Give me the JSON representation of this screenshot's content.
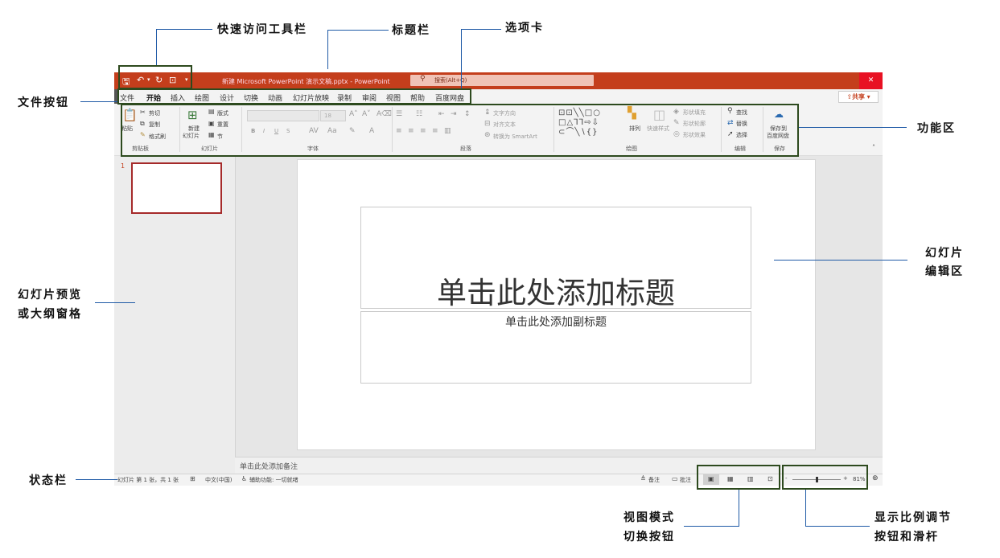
{
  "annotations": {
    "qat": "快速访问工具栏",
    "titlebar": "标题栏",
    "tabs": "选项卡",
    "file_button": "文件按钮",
    "ribbon": "功能区",
    "edit_area_1": "幻灯片",
    "edit_area_2": "编辑区",
    "preview_1": "幻灯片预览",
    "preview_2": "或大纲窗格",
    "statusbar": "状态栏",
    "view_buttons_1": "视图模式",
    "view_buttons_2": "切换按钮",
    "zoom_1": "显示比例调节",
    "zoom_2": "按钮和滑杆"
  },
  "window": {
    "title": "新建 Microsoft PowerPoint 演示文稿.pptx - PowerPoint",
    "search_placeholder": "搜索(Alt+Q)",
    "share": "共享",
    "close": "✕"
  },
  "tabs": [
    "文件",
    "开始",
    "插入",
    "绘图",
    "设计",
    "切换",
    "动画",
    "幻灯片放映",
    "录制",
    "审阅",
    "视图",
    "帮助",
    "百度网盘"
  ],
  "ribbon": {
    "clipboard": {
      "paste": "粘贴",
      "cut": "剪切",
      "copy": "复制",
      "format_painter": "格式刷",
      "label": "剪贴板"
    },
    "slides": {
      "new_1": "新建",
      "new_2": "幻灯片",
      "layout": "版式",
      "reset": "重置",
      "section": "节",
      "label": "幻灯片"
    },
    "font": {
      "size": "18",
      "bold": "B",
      "italic": "I",
      "underline": "U",
      "strike": "S",
      "label": "字体"
    },
    "paragraph": {
      "text_dir": "文字方向",
      "align_text": "对齐文本",
      "smartart": "转换为 SmartArt",
      "label": "段落"
    },
    "drawing": {
      "arrange": "排列",
      "quick_styles": "快速样式",
      "fill": "形状填充",
      "outline": "形状轮廓",
      "effects": "形状效果",
      "label": "绘图"
    },
    "editing": {
      "find": "查找",
      "replace": "替换",
      "select": "选择",
      "label": "编辑"
    },
    "save": {
      "save_1": "保存到",
      "save_2": "百度网盘",
      "label": "保存"
    }
  },
  "slide": {
    "number": "1",
    "title_placeholder": "单击此处添加标题",
    "subtitle_placeholder": "单击此处添加副标题"
  },
  "notes_placeholder": "单击此处添加备注",
  "status": {
    "slide_info": "幻灯片 第 1 张，共 1 张",
    "language": "中文(中国)",
    "accessibility": "辅助功能: 一切就绪",
    "notes": "备注",
    "comments": "批注",
    "zoom_minus": "-",
    "zoom_plus": "+",
    "zoom": "81%"
  },
  "colors": {
    "accent": "#c43e1c",
    "annotation_line": "#1f5aa6",
    "annotation_box": "#2d4a1e"
  },
  "zoom_slider_fraction": 0.5
}
